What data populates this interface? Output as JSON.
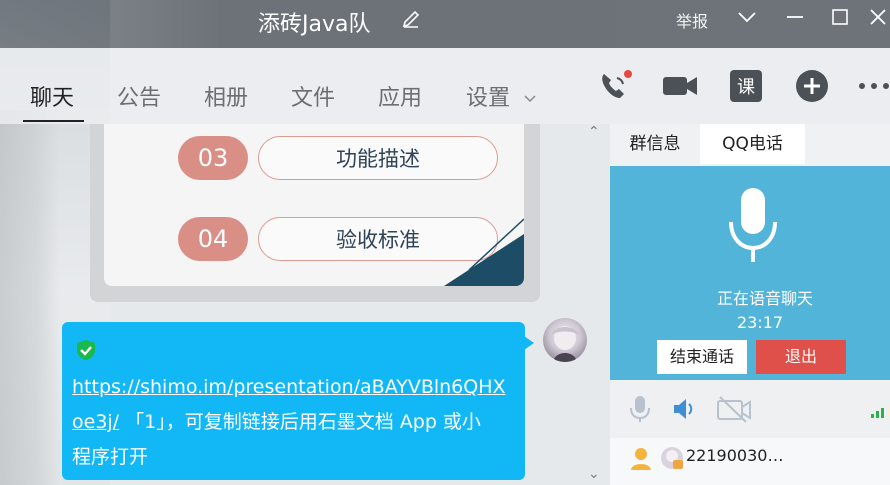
{
  "window": {
    "title": "添砖Java队",
    "report_label": "举报"
  },
  "tabs": [
    {
      "label": "聊天",
      "active": true
    },
    {
      "label": "公告"
    },
    {
      "label": "相册"
    },
    {
      "label": "文件"
    },
    {
      "label": "应用"
    },
    {
      "label": "设置"
    }
  ],
  "slide_card": {
    "items": [
      {
        "num": "03",
        "label": "功能描述"
      },
      {
        "num": "04",
        "label": "验收标准"
      }
    ]
  },
  "message": {
    "link": "https://shimo.im/presentation/aBAYVBln6QHXoe3j/",
    "link_line1": "https://shimo.im/presentation/aBAYVBln6QHX",
    "link_line2": "oe3j/",
    "text_after_link": " 「1」，可复制链接后用石墨文档 App 或小",
    "text_line3": "程序打开"
  },
  "right_panel": {
    "tabs": [
      {
        "label": "群信息"
      },
      {
        "label": "QQ电话",
        "active": true
      }
    ],
    "call": {
      "status": "正在语音聊天",
      "time": "23:17",
      "end_label": "结束通话",
      "quit_label": "退出"
    },
    "member": {
      "name": "22190030…"
    }
  },
  "colors": {
    "message_bubble": "#12b7f5",
    "call_panel": "#52b4d9",
    "quit_button": "#e0504a",
    "pill_accent": "#d98e86"
  }
}
